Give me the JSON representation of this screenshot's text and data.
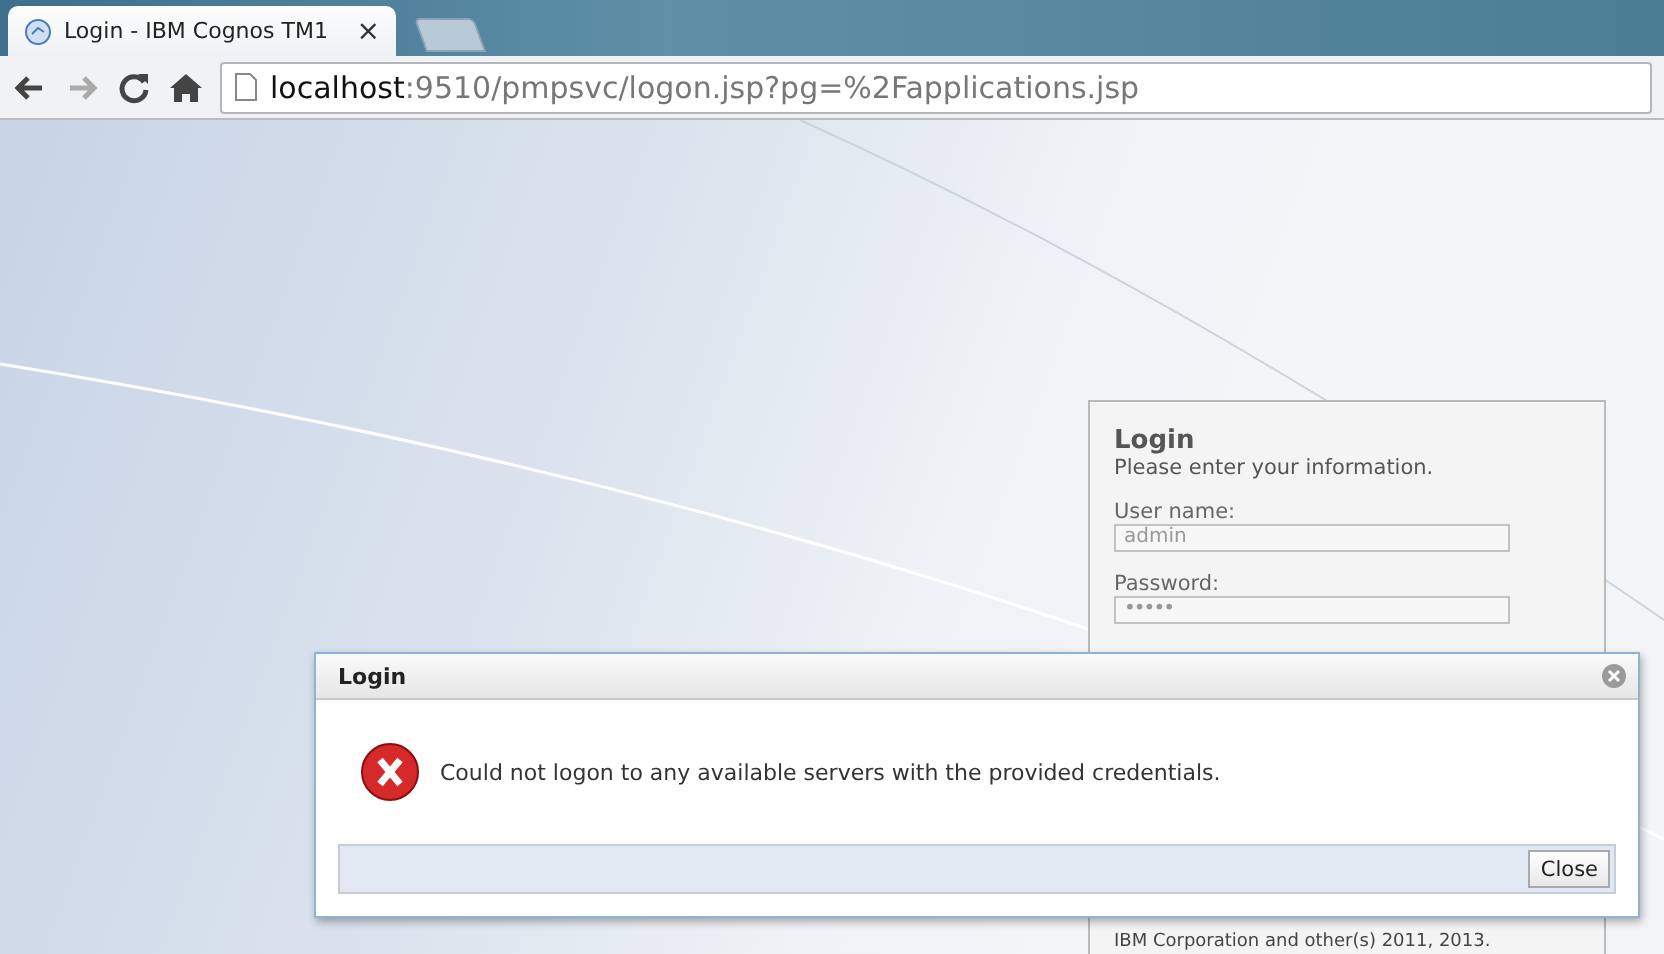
{
  "browser": {
    "tab_title": "Login - IBM Cognos TM1",
    "tab_close": "×",
    "url_host": "localhost",
    "url_path": ":9510/pmpsvc/logon.jsp?pg=%2Fapplications.jsp"
  },
  "login_panel": {
    "title": "Login",
    "subtitle": "Please enter your information.",
    "fields": [
      {
        "label": "User name:",
        "value": "admin",
        "kind": "text"
      },
      {
        "label": "Password:",
        "value": "•••••",
        "kind": "password"
      }
    ],
    "footer": "IBM Corporation and other(s) 2011, 2013."
  },
  "dialog": {
    "title": "Login",
    "message": "Could not logon to any available servers with the provided credentials.",
    "buttons": [
      "Close"
    ]
  }
}
